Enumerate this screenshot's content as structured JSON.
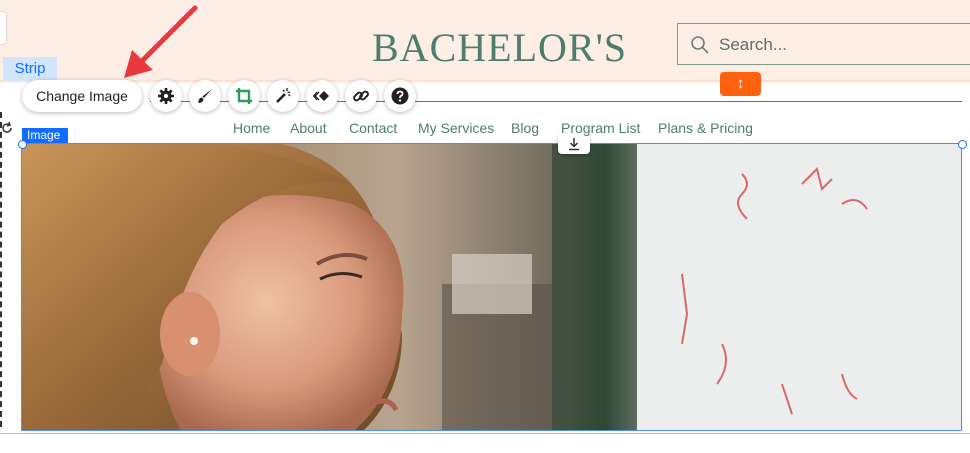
{
  "header": {
    "site_title": "BACHELOR'S",
    "search_placeholder": "Search..."
  },
  "editor": {
    "strip_label": "Strip",
    "image_label": "Image",
    "stretch_handle_glyph": "↕",
    "accent_color": "#116dff",
    "handle_color": "#fe620f"
  },
  "toolbar": {
    "change_image_label": "Change Image",
    "tools": [
      "settings-icon",
      "brush-icon",
      "crop-icon",
      "magic-wand-icon",
      "animation-icon",
      "link-icon",
      "help-icon"
    ]
  },
  "nav": {
    "items": [
      "Home",
      "About",
      "Contact",
      "My Services",
      "Blog",
      "Program List",
      "Plans & Pricing"
    ]
  },
  "colors": {
    "header_bg": "#fdeee5",
    "brand_green": "#4f7d6d",
    "arrow_red": "#e8393f"
  }
}
